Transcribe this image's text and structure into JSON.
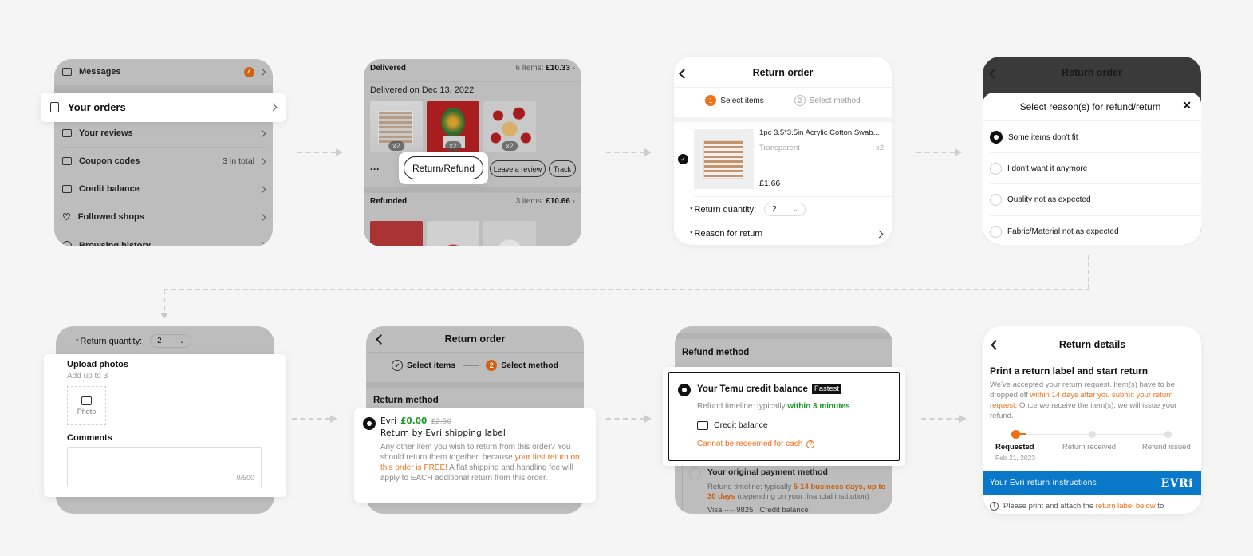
{
  "colors": {
    "accent": "#f0701a",
    "green": "#1a9b2a",
    "evri_blue": "#0a78c8",
    "badge_orange": "#d2600f"
  },
  "panel1": {
    "items": [
      {
        "icon": "message-icon",
        "label": "Messages",
        "badge": "4"
      },
      {
        "icon": "orders-icon",
        "label": "Your orders"
      },
      {
        "icon": "review-icon",
        "label": "Your reviews"
      },
      {
        "icon": "coupon-icon",
        "label": "Coupon codes",
        "value": "3 in total"
      },
      {
        "icon": "wallet-icon",
        "label": "Credit balance"
      },
      {
        "icon": "heart-icon",
        "label": "Followed shops"
      },
      {
        "icon": "history-icon",
        "label": "Browsing history"
      }
    ]
  },
  "panel2": {
    "delivered_label": "Delivered",
    "delivered_items": "6 items:",
    "delivered_total": "£10.33",
    "delivered_date": "Delivered on Dec 13, 2022",
    "thumb_qty": [
      "x2",
      "x2",
      "x2"
    ],
    "more": "···",
    "return_refund": "Return/Refund",
    "leave_review": "Leave a review",
    "track": "Track",
    "refunded_label": "Refunded",
    "refunded_items": "3 items:",
    "refunded_total": "£10.66"
  },
  "panel3": {
    "title": "Return order",
    "step1_num": "1",
    "step1": "Select items",
    "step2_num": "2",
    "step2": "Select method",
    "product_name": "1pc 3.5*3.5in Acrylic Cotton Swab...",
    "variant": "Transparent",
    "qty": "x2",
    "price": "£1.66",
    "return_qty_label": "Return quantity:",
    "return_qty_value": "2",
    "reason_label": "Reason for return"
  },
  "panel4": {
    "title": "Return order",
    "sheet_title": "Select reason(s) for refund/return",
    "reasons": [
      {
        "label": "Some items don't fit",
        "selected": true
      },
      {
        "label": "I don't want it anymore",
        "selected": false
      },
      {
        "label": "Quality not as expected",
        "selected": false
      },
      {
        "label": "Fabric/Material not as expected",
        "selected": false
      }
    ]
  },
  "panel5": {
    "return_qty_label": "Return quantity:",
    "return_qty_value": "2",
    "upload_title": "Upload photos",
    "upload_sub": "Add up to 3",
    "photo_label": "Photo",
    "comments_label": "Comments",
    "comments_value": "",
    "counter": "0/500"
  },
  "panel6": {
    "title": "Return order",
    "step1": "Select items",
    "step2_num": "2",
    "step2": "Select method",
    "section": "Return method",
    "carrier": "Evri",
    "price_now": "£0.00",
    "price_old": "£2.50",
    "method_title": "Return by Evri shipping label",
    "desc_1": "Any other item you wish to return from this order? You should return them together, because ",
    "desc_highlight": "your first return on this order is FREE!",
    "desc_2": " A flat shipping and handling fee will apply to EACH additional return from this order."
  },
  "panel7": {
    "section": "Refund method",
    "option1_title": "Your Temu credit balance",
    "option1_badge": "Fastest",
    "option1_timeline_pre": "Refund timeline: typically ",
    "option1_timeline_hl": "within 3 minutes",
    "option1_dest": "Credit balance",
    "option1_warning": "Cannot be redeemed for cash",
    "option2_title": "Your original payment method",
    "option2_timeline_pre": "Refund timeline: typically ",
    "option2_timeline_hl": "5-14 business days, up to 30 days",
    "option2_timeline_post": " (depending on your financial institution)",
    "option2_card": "Visa ···· 9825",
    "option2_dest": "Credit balance"
  },
  "panel8": {
    "title": "Return details",
    "heading": "Print a return label and start return",
    "body_1": "We've accepted your return request. Item(s) have to be dropped off ",
    "body_hl": "within 14 days after you submit your return request.",
    "body_2": " Once we receive the item(s), we will issue your refund.",
    "steps": [
      {
        "label": "Requested",
        "date": "Feb 21, 2023",
        "active": true
      },
      {
        "label": "Return received",
        "active": false
      },
      {
        "label": "Refund issued",
        "active": false
      }
    ],
    "banner": "Your Evri return instructions",
    "banner_logo": "EVRi",
    "instr_num": "1",
    "instr_pre": "Please print and attach the ",
    "instr_hl": "return label below",
    "instr_post": " to"
  }
}
